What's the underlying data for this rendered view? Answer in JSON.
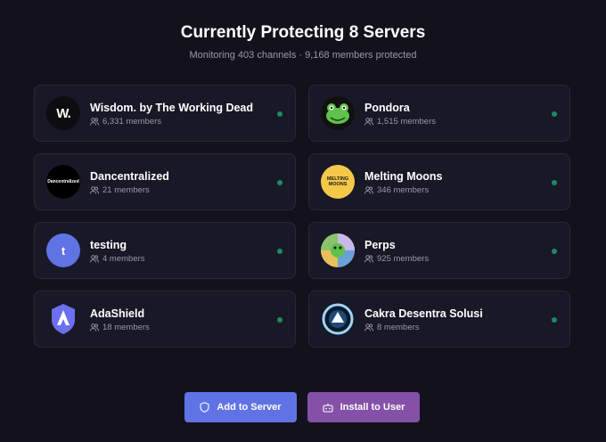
{
  "header": {
    "title": "Currently Protecting 8 Servers",
    "subtitle": "Monitoring 403 channels · 9,168 members protected"
  },
  "servers": [
    {
      "name": "Wisdom. by The Working Dead",
      "members": "6,331 members",
      "avatar_text": "W.",
      "avatar_color": "#0d0d0f",
      "status_color": "#1f8a63"
    },
    {
      "name": "Pondora",
      "members": "1,515 members",
      "avatar_text": "",
      "avatar_color": "#111111",
      "status_color": "#1f8a63"
    },
    {
      "name": "Dancentralized",
      "members": "21 members",
      "avatar_text": "Dancentralized",
      "avatar_color": "#000000",
      "status_color": "#1f8a63"
    },
    {
      "name": "Melting Moons",
      "members": "346 members",
      "avatar_text": "MELTING MOONS",
      "avatar_color": "#f6c84a",
      "status_color": "#1f8a63"
    },
    {
      "name": "testing",
      "members": "4 members",
      "avatar_text": "t",
      "avatar_color": "#5f73e4",
      "status_color": "#1f8a63"
    },
    {
      "name": "Perps",
      "members": "925 members",
      "avatar_text": "",
      "avatar_color": "#7fb08a",
      "status_color": "#1f8a63"
    },
    {
      "name": "AdaShield",
      "members": "18 members",
      "avatar_text": "",
      "avatar_color": "#191826",
      "status_color": "#1f8a63"
    },
    {
      "name": "Cakra Desentra Solusi",
      "members": "8 members",
      "avatar_text": "",
      "avatar_color": "#0d1a26",
      "status_color": "#1f8a63"
    }
  ],
  "actions": {
    "add_label": "Add to Server",
    "install_label": "Install to User"
  },
  "colors": {
    "background": "#13121c",
    "card": "#191826",
    "primary": "#5f73e4",
    "secondary": "#8450a8",
    "online": "#1f8a63"
  }
}
